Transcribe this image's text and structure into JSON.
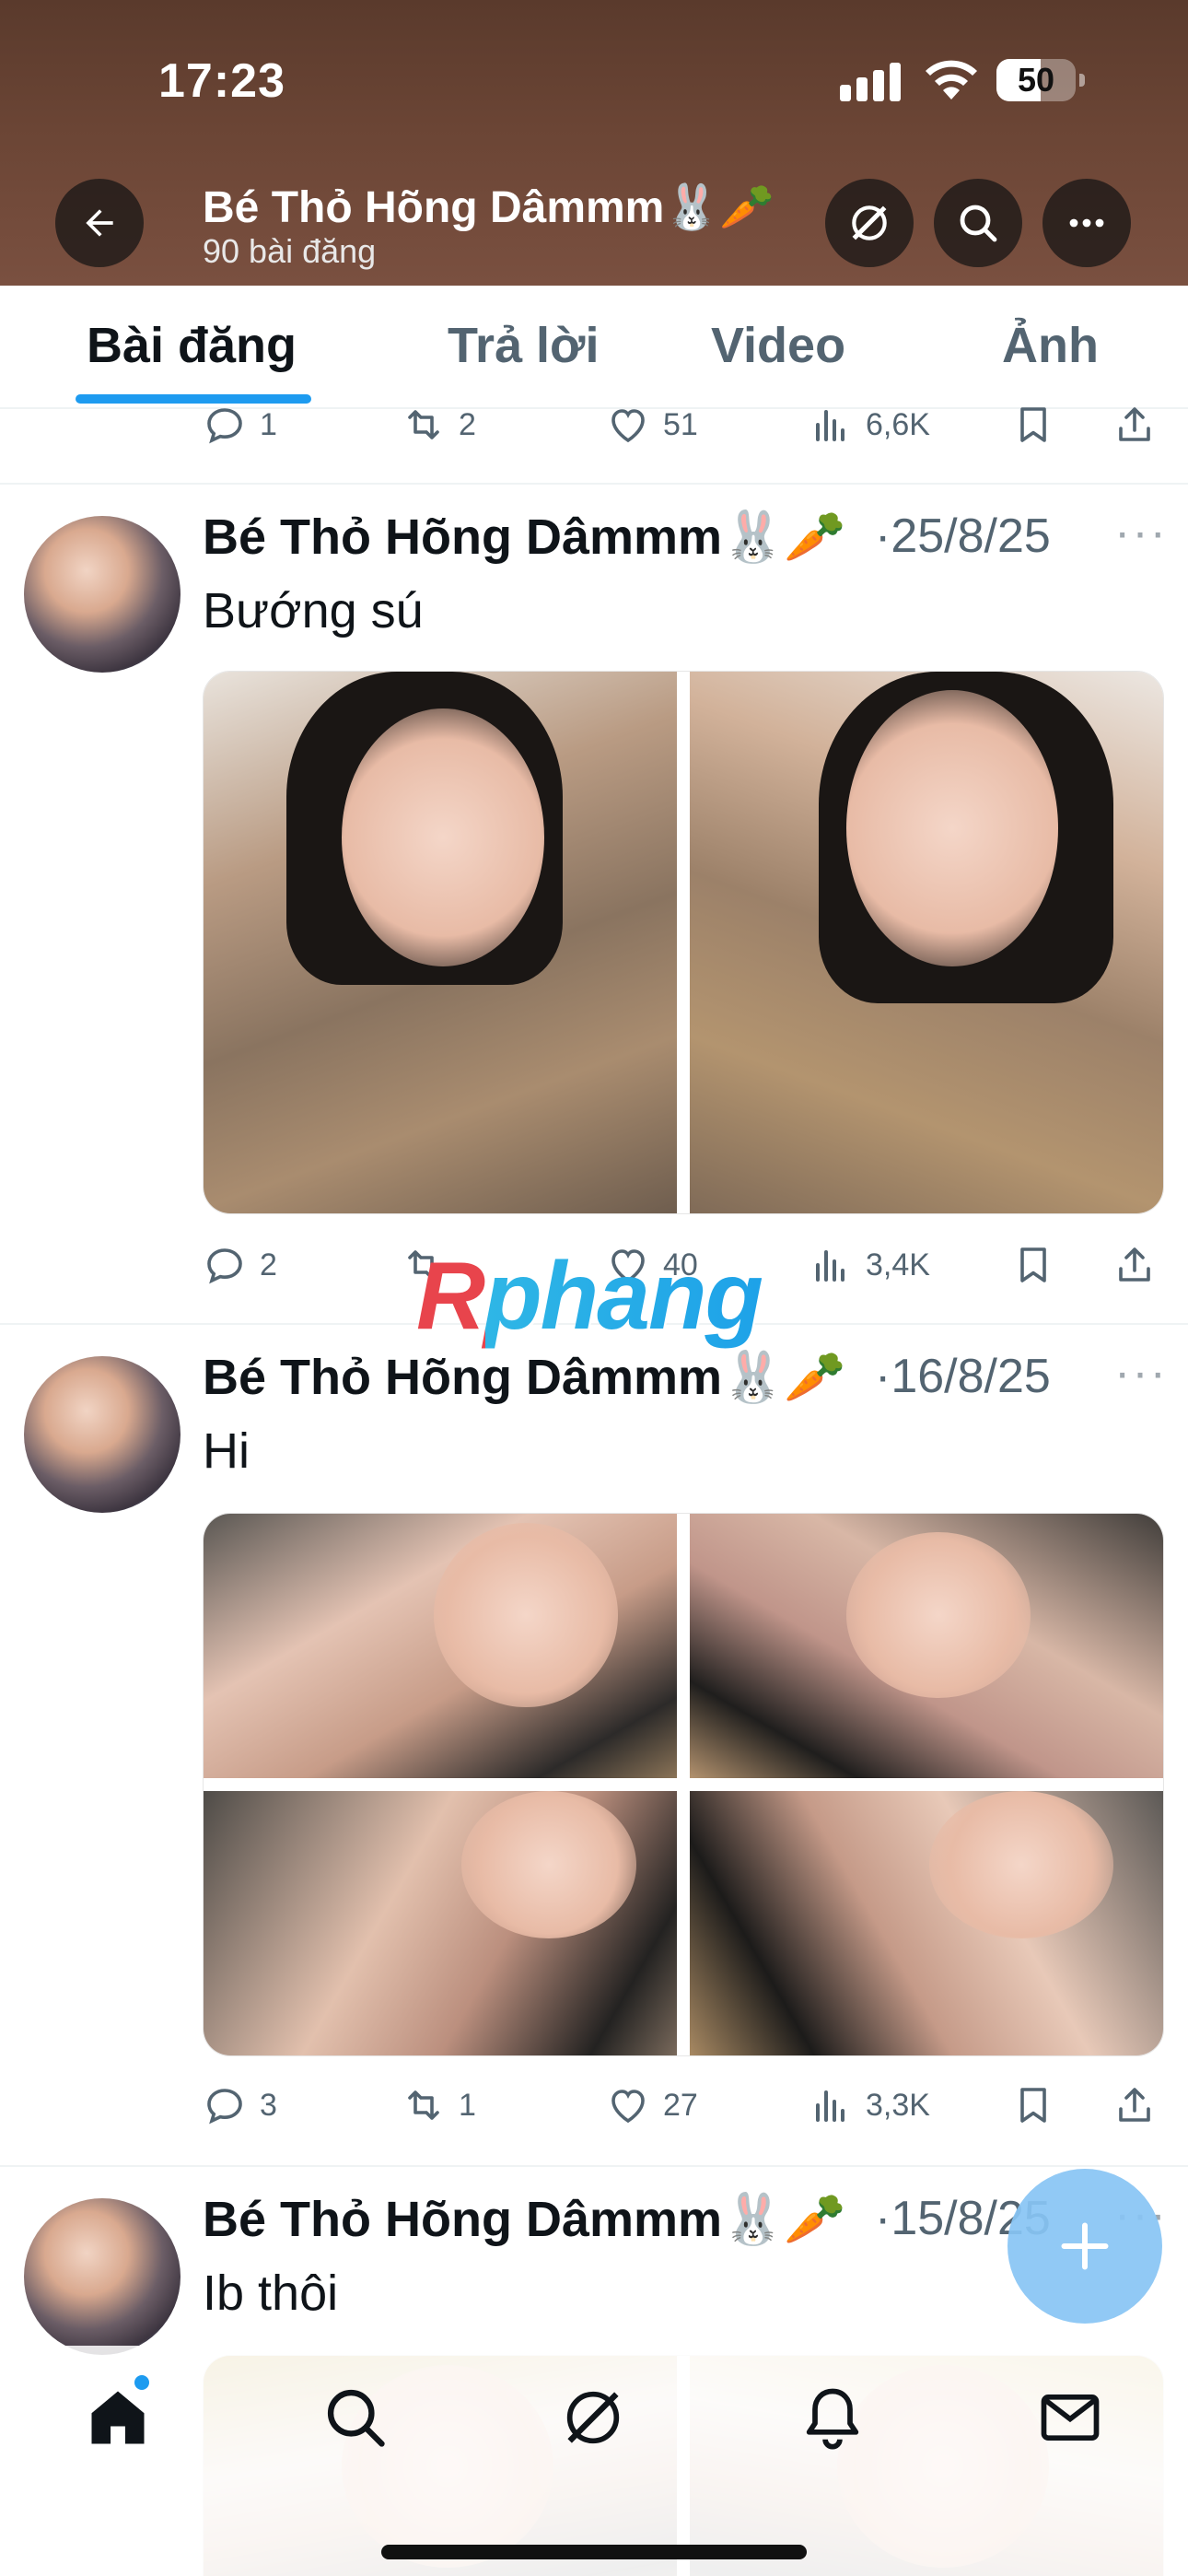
{
  "status": {
    "time": "17:23",
    "battery": "50"
  },
  "header": {
    "name": "Bé Thỏ Hõng Dâmmm🐰🥕",
    "post_count": "90 bài đăng"
  },
  "tabs": [
    {
      "label": "Bài đăng",
      "active": true
    },
    {
      "label": "Trả lời",
      "active": false
    },
    {
      "label": "Video",
      "active": false
    },
    {
      "label": "Ảnh",
      "active": false
    }
  ],
  "prev_post_actions": {
    "replies": "1",
    "reposts": "2",
    "likes": "51",
    "views": "6,6K"
  },
  "posts": [
    {
      "author": "Bé Thỏ Hõng Dâmmm🐰🥕",
      "date": "·25/8/25",
      "text": "Bướng sú",
      "replies": "2",
      "reposts": "",
      "likes": "40",
      "views": "3,4K"
    },
    {
      "author": "Bé Thỏ Hõng Dâmmm🐰🥕",
      "date": "·16/8/25",
      "text": "Hi",
      "replies": "3",
      "reposts": "1",
      "likes": "27",
      "views": "3,3K"
    },
    {
      "author": "Bé Thỏ Hõng Dâmmm🐰🥕",
      "date": "·15/8/25",
      "text": "Ib thôi"
    }
  ],
  "more_glyph": "···",
  "watermark": "Rphang",
  "accent": "#1d9bf0"
}
